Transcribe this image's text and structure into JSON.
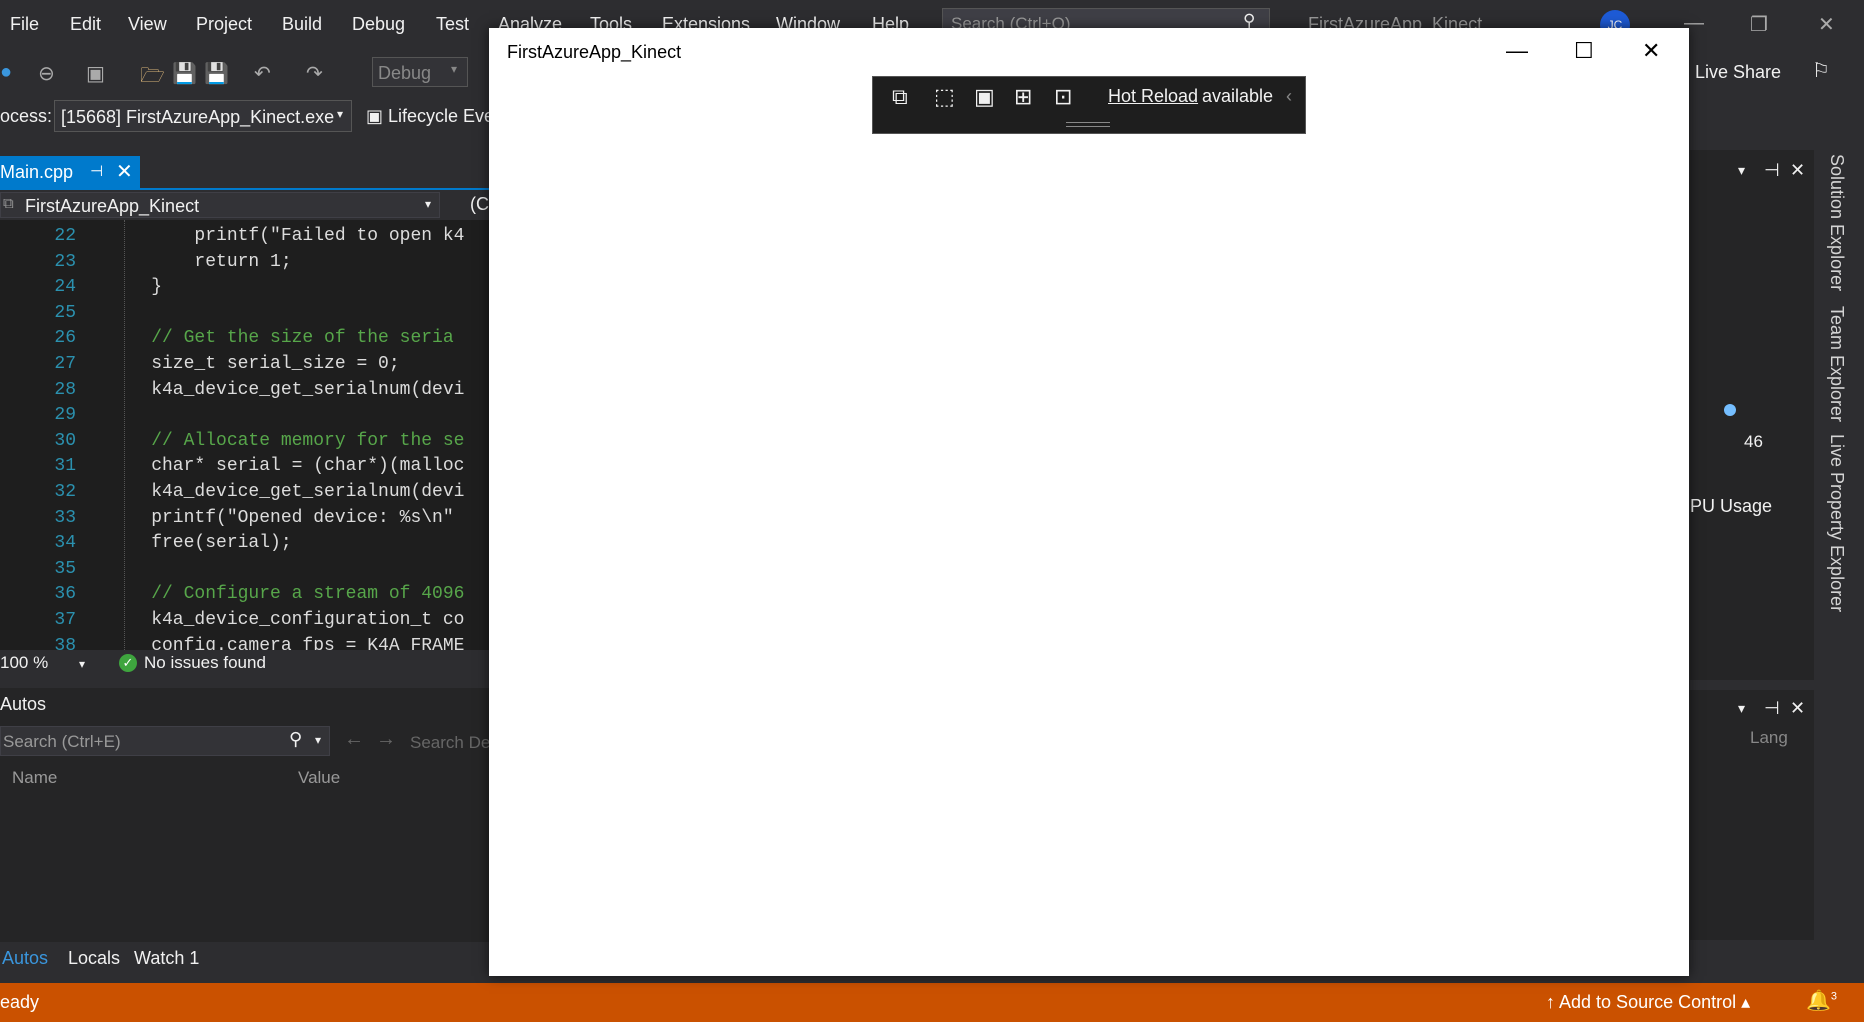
{
  "menu": {
    "items": [
      "File",
      "Edit",
      "View",
      "Project",
      "Build",
      "Debug",
      "Test",
      "Analyze",
      "Tools",
      "Extensions",
      "Window",
      "Help"
    ],
    "search_placeholder": "Search (Ctrl+Q)",
    "solution_title": "FirstAzureApp_Kinect",
    "avatar_initials": "JC"
  },
  "toolbar": {
    "config": "Debug",
    "live_share": "Live Share"
  },
  "process_bar": {
    "label": "ocess:",
    "process": "[15668] FirstAzureApp_Kinect.exe",
    "lifecycle": "Lifecycle Eve"
  },
  "editor": {
    "tab_label": "Main.cpp",
    "nav_project": "FirstAzureApp_Kinect",
    "nav_scope": "(C",
    "zoom": "100 %",
    "issues": "No issues found",
    "lines": [
      {
        "num": "22",
        "text": "        printf(\"Failed to open k4"
      },
      {
        "num": "23",
        "text": "        return 1;"
      },
      {
        "num": "24",
        "text": "    }"
      },
      {
        "num": "25",
        "text": ""
      },
      {
        "num": "26",
        "text": "    // Get the size of the seria"
      },
      {
        "num": "27",
        "text": "    size_t serial_size = 0;"
      },
      {
        "num": "28",
        "text": "    k4a_device_get_serialnum(devi"
      },
      {
        "num": "29",
        "text": ""
      },
      {
        "num": "30",
        "text": "    // Allocate memory for the se"
      },
      {
        "num": "31",
        "text": "    char* serial = (char*)(malloc"
      },
      {
        "num": "32",
        "text": "    k4a_device_get_serialnum(devi"
      },
      {
        "num": "33",
        "text": "    printf(\"Opened device: %s\\n\""
      },
      {
        "num": "34",
        "text": "    free(serial);"
      },
      {
        "num": "35",
        "text": ""
      },
      {
        "num": "36",
        "text": "    // Configure a stream of 4096"
      },
      {
        "num": "37",
        "text": "    k4a_device_configuration_t co"
      },
      {
        "num": "38",
        "text": "    config.camera_fps = K4A_FRAME"
      }
    ]
  },
  "autos": {
    "title": "Autos",
    "search_placeholder": "Search (Ctrl+E)",
    "search_depth": "Search De",
    "col_name": "Name",
    "col_value": "Value",
    "tabs": [
      "Autos",
      "Locals",
      "Watch 1"
    ]
  },
  "right": {
    "side_tabs": [
      "Solution Explorer",
      "Team Explorer",
      "Live Property Explorer"
    ],
    "cpu": "PU Usage",
    "value46": "46",
    "lang": "Lang"
  },
  "status": {
    "ready": "eady",
    "source_control": "Add to Source Control",
    "notifications": "3"
  },
  "app_window": {
    "title": "FirstAzureApp_Kinect",
    "hot_reload_link": "Hot Reload",
    "hot_reload_text": "available"
  },
  "colors": {
    "status_bar": "#ca5100",
    "accent": "#007acc",
    "editor_bg": "#1e1e1e"
  }
}
